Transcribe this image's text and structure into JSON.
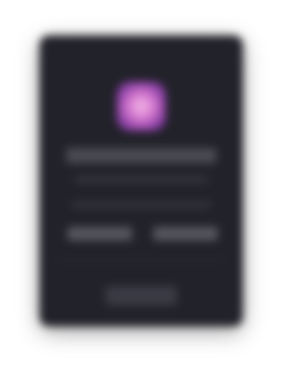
{
  "dialog": {
    "icon": "app-icon",
    "title": "",
    "subtitle": "",
    "description": "",
    "options": [
      {
        "label": ""
      },
      {
        "label": ""
      }
    ],
    "primary_button": {
      "label": ""
    }
  },
  "colors": {
    "card_background": "#22222a",
    "icon_accent": "#d77ad0"
  }
}
